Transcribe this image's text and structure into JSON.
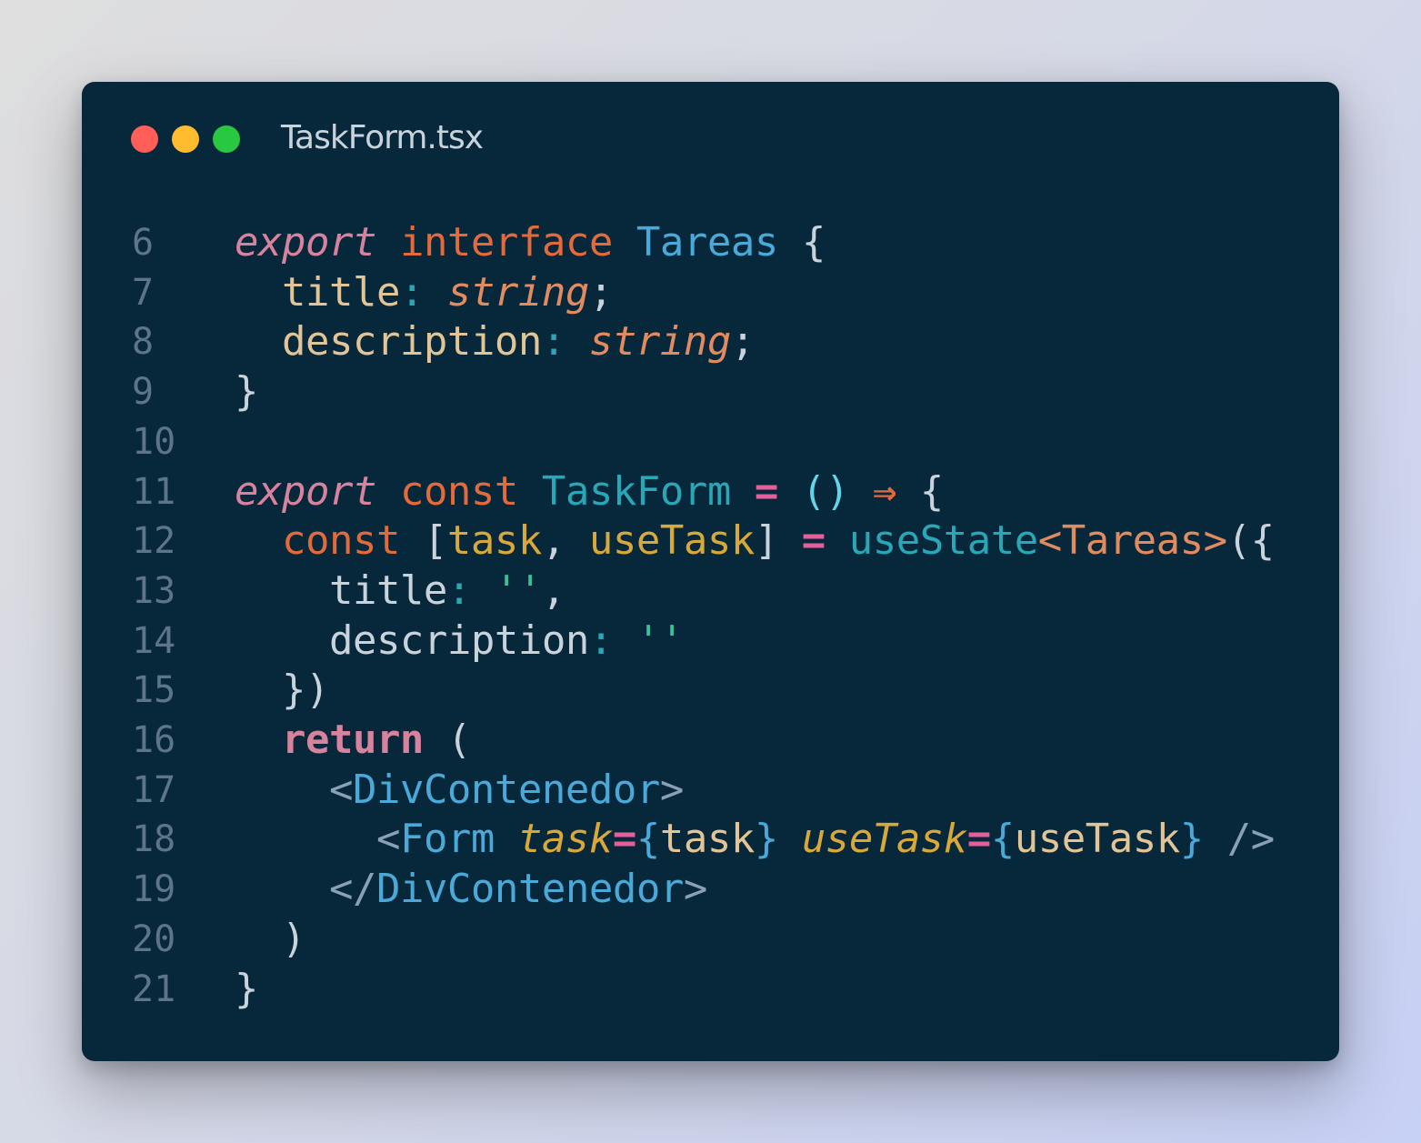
{
  "window": {
    "filename": "TaskForm.tsx"
  },
  "lines": [
    {
      "num": "6",
      "tokens": [
        [
          "kw-it",
          "export"
        ],
        [
          "plain",
          " "
        ],
        [
          "kw",
          "interface"
        ],
        [
          "plain",
          " "
        ],
        [
          "type",
          "Tareas"
        ],
        [
          "plain",
          " {"
        ]
      ]
    },
    {
      "num": "7",
      "tokens": [
        [
          "plain",
          "  "
        ],
        [
          "prop",
          "title"
        ],
        [
          "teal",
          ":"
        ],
        [
          "plain",
          " "
        ],
        [
          "str-type",
          "string"
        ],
        [
          "plain",
          ";"
        ]
      ]
    },
    {
      "num": "8",
      "tokens": [
        [
          "plain",
          "  "
        ],
        [
          "prop",
          "description"
        ],
        [
          "teal",
          ":"
        ],
        [
          "plain",
          " "
        ],
        [
          "str-type",
          "string"
        ],
        [
          "plain",
          ";"
        ]
      ]
    },
    {
      "num": "9",
      "tokens": [
        [
          "plain",
          "}"
        ]
      ]
    },
    {
      "num": "10",
      "tokens": []
    },
    {
      "num": "11",
      "tokens": [
        [
          "kw-it",
          "export"
        ],
        [
          "plain",
          " "
        ],
        [
          "kw",
          "const"
        ],
        [
          "plain",
          " "
        ],
        [
          "teal",
          "TaskForm"
        ],
        [
          "plain",
          " "
        ],
        [
          "op",
          "="
        ],
        [
          "plain",
          " "
        ],
        [
          "cyan",
          "()"
        ],
        [
          "plain",
          " "
        ],
        [
          "arrow",
          "⇒"
        ],
        [
          "plain",
          " {"
        ]
      ]
    },
    {
      "num": "12",
      "tokens": [
        [
          "plain",
          "  "
        ],
        [
          "kw",
          "const"
        ],
        [
          "plain",
          " ["
        ],
        [
          "var",
          "task"
        ],
        [
          "plain",
          ", "
        ],
        [
          "var",
          "useTask"
        ],
        [
          "plain",
          "] "
        ],
        [
          "op",
          "="
        ],
        [
          "plain",
          " "
        ],
        [
          "fn",
          "useState"
        ],
        [
          "gen",
          "<Tareas>"
        ],
        [
          "plain",
          "({"
        ]
      ]
    },
    {
      "num": "13",
      "tokens": [
        [
          "plain",
          "    title"
        ],
        [
          "teal",
          ":"
        ],
        [
          "plain",
          " "
        ],
        [
          "str",
          "''"
        ],
        [
          "plain",
          ","
        ]
      ]
    },
    {
      "num": "14",
      "tokens": [
        [
          "plain",
          "    description"
        ],
        [
          "teal",
          ":"
        ],
        [
          "plain",
          " "
        ],
        [
          "str",
          "''"
        ]
      ]
    },
    {
      "num": "15",
      "tokens": [
        [
          "plain",
          "  })"
        ]
      ]
    },
    {
      "num": "16",
      "tokens": [
        [
          "plain",
          "  "
        ],
        [
          "ret",
          "return"
        ],
        [
          "plain",
          " ("
        ]
      ]
    },
    {
      "num": "17",
      "tokens": [
        [
          "plain",
          "    "
        ],
        [
          "tagp",
          "<"
        ],
        [
          "tag",
          "DivContenedor"
        ],
        [
          "tagp",
          ">"
        ]
      ]
    },
    {
      "num": "18",
      "tokens": [
        [
          "plain",
          "      "
        ],
        [
          "tagp",
          "<"
        ],
        [
          "tag",
          "Form"
        ],
        [
          "plain",
          " "
        ],
        [
          "attr",
          "task"
        ],
        [
          "op",
          "="
        ],
        [
          "brace",
          "{"
        ],
        [
          "jsx-val",
          "task"
        ],
        [
          "brace",
          "}"
        ],
        [
          "plain",
          " "
        ],
        [
          "attr",
          "useTask"
        ],
        [
          "op",
          "="
        ],
        [
          "brace",
          "{"
        ],
        [
          "jsx-val",
          "useTask"
        ],
        [
          "brace",
          "}"
        ],
        [
          "plain",
          " "
        ],
        [
          "tagp",
          "/>"
        ]
      ]
    },
    {
      "num": "19",
      "tokens": [
        [
          "plain",
          "    "
        ],
        [
          "tagp",
          "</"
        ],
        [
          "tag",
          "DivContenedor"
        ],
        [
          "tagp",
          ">"
        ]
      ]
    },
    {
      "num": "20",
      "tokens": [
        [
          "plain",
          "  )"
        ]
      ]
    },
    {
      "num": "21",
      "tokens": [
        [
          "plain",
          "}"
        ]
      ]
    }
  ]
}
